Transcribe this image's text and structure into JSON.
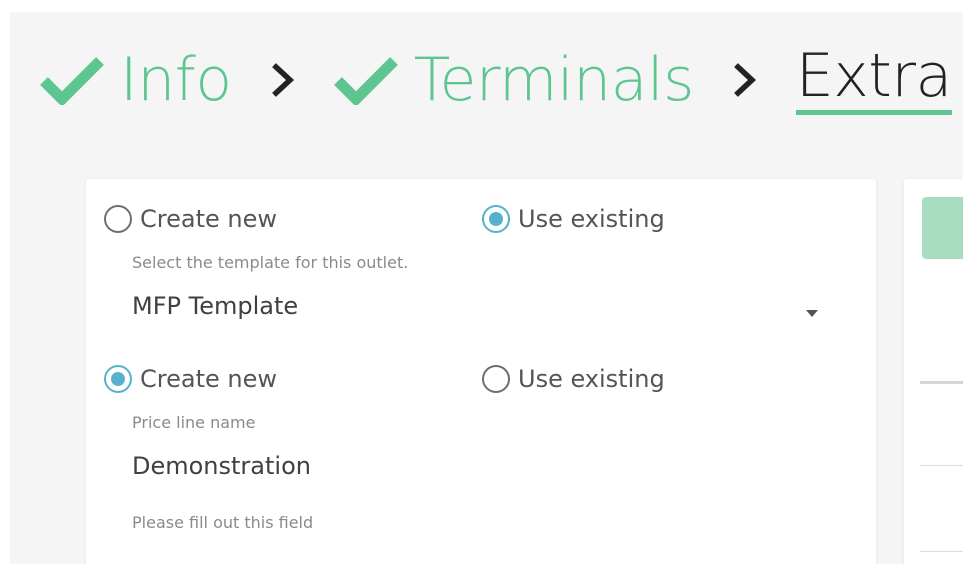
{
  "stepper": {
    "steps": [
      {
        "label": "Info",
        "state": "done",
        "icon": "check-icon"
      },
      {
        "label": "Terminals",
        "state": "done",
        "icon": "check-icon"
      },
      {
        "label": "Extra",
        "state": "current"
      }
    ],
    "separator_icon": "chevron-right-icon"
  },
  "template_section": {
    "options": [
      {
        "label": "Create new",
        "selected": false
      },
      {
        "label": "Use existing",
        "selected": true
      }
    ],
    "helper": "Select the template for this outlet.",
    "value": "MFP Template",
    "dropdown_icon": "caret-down-icon"
  },
  "price_line_section": {
    "options": [
      {
        "label": "Create new",
        "selected": true
      },
      {
        "label": "Use existing",
        "selected": false
      }
    ],
    "field_label": "Price line name",
    "value": "Demonstration",
    "validation": "Please fill out this field"
  },
  "colors": {
    "accent_green": "#5dc58f",
    "radio_blue": "#56b2cc",
    "button_green_light": "#a9ddc0"
  }
}
